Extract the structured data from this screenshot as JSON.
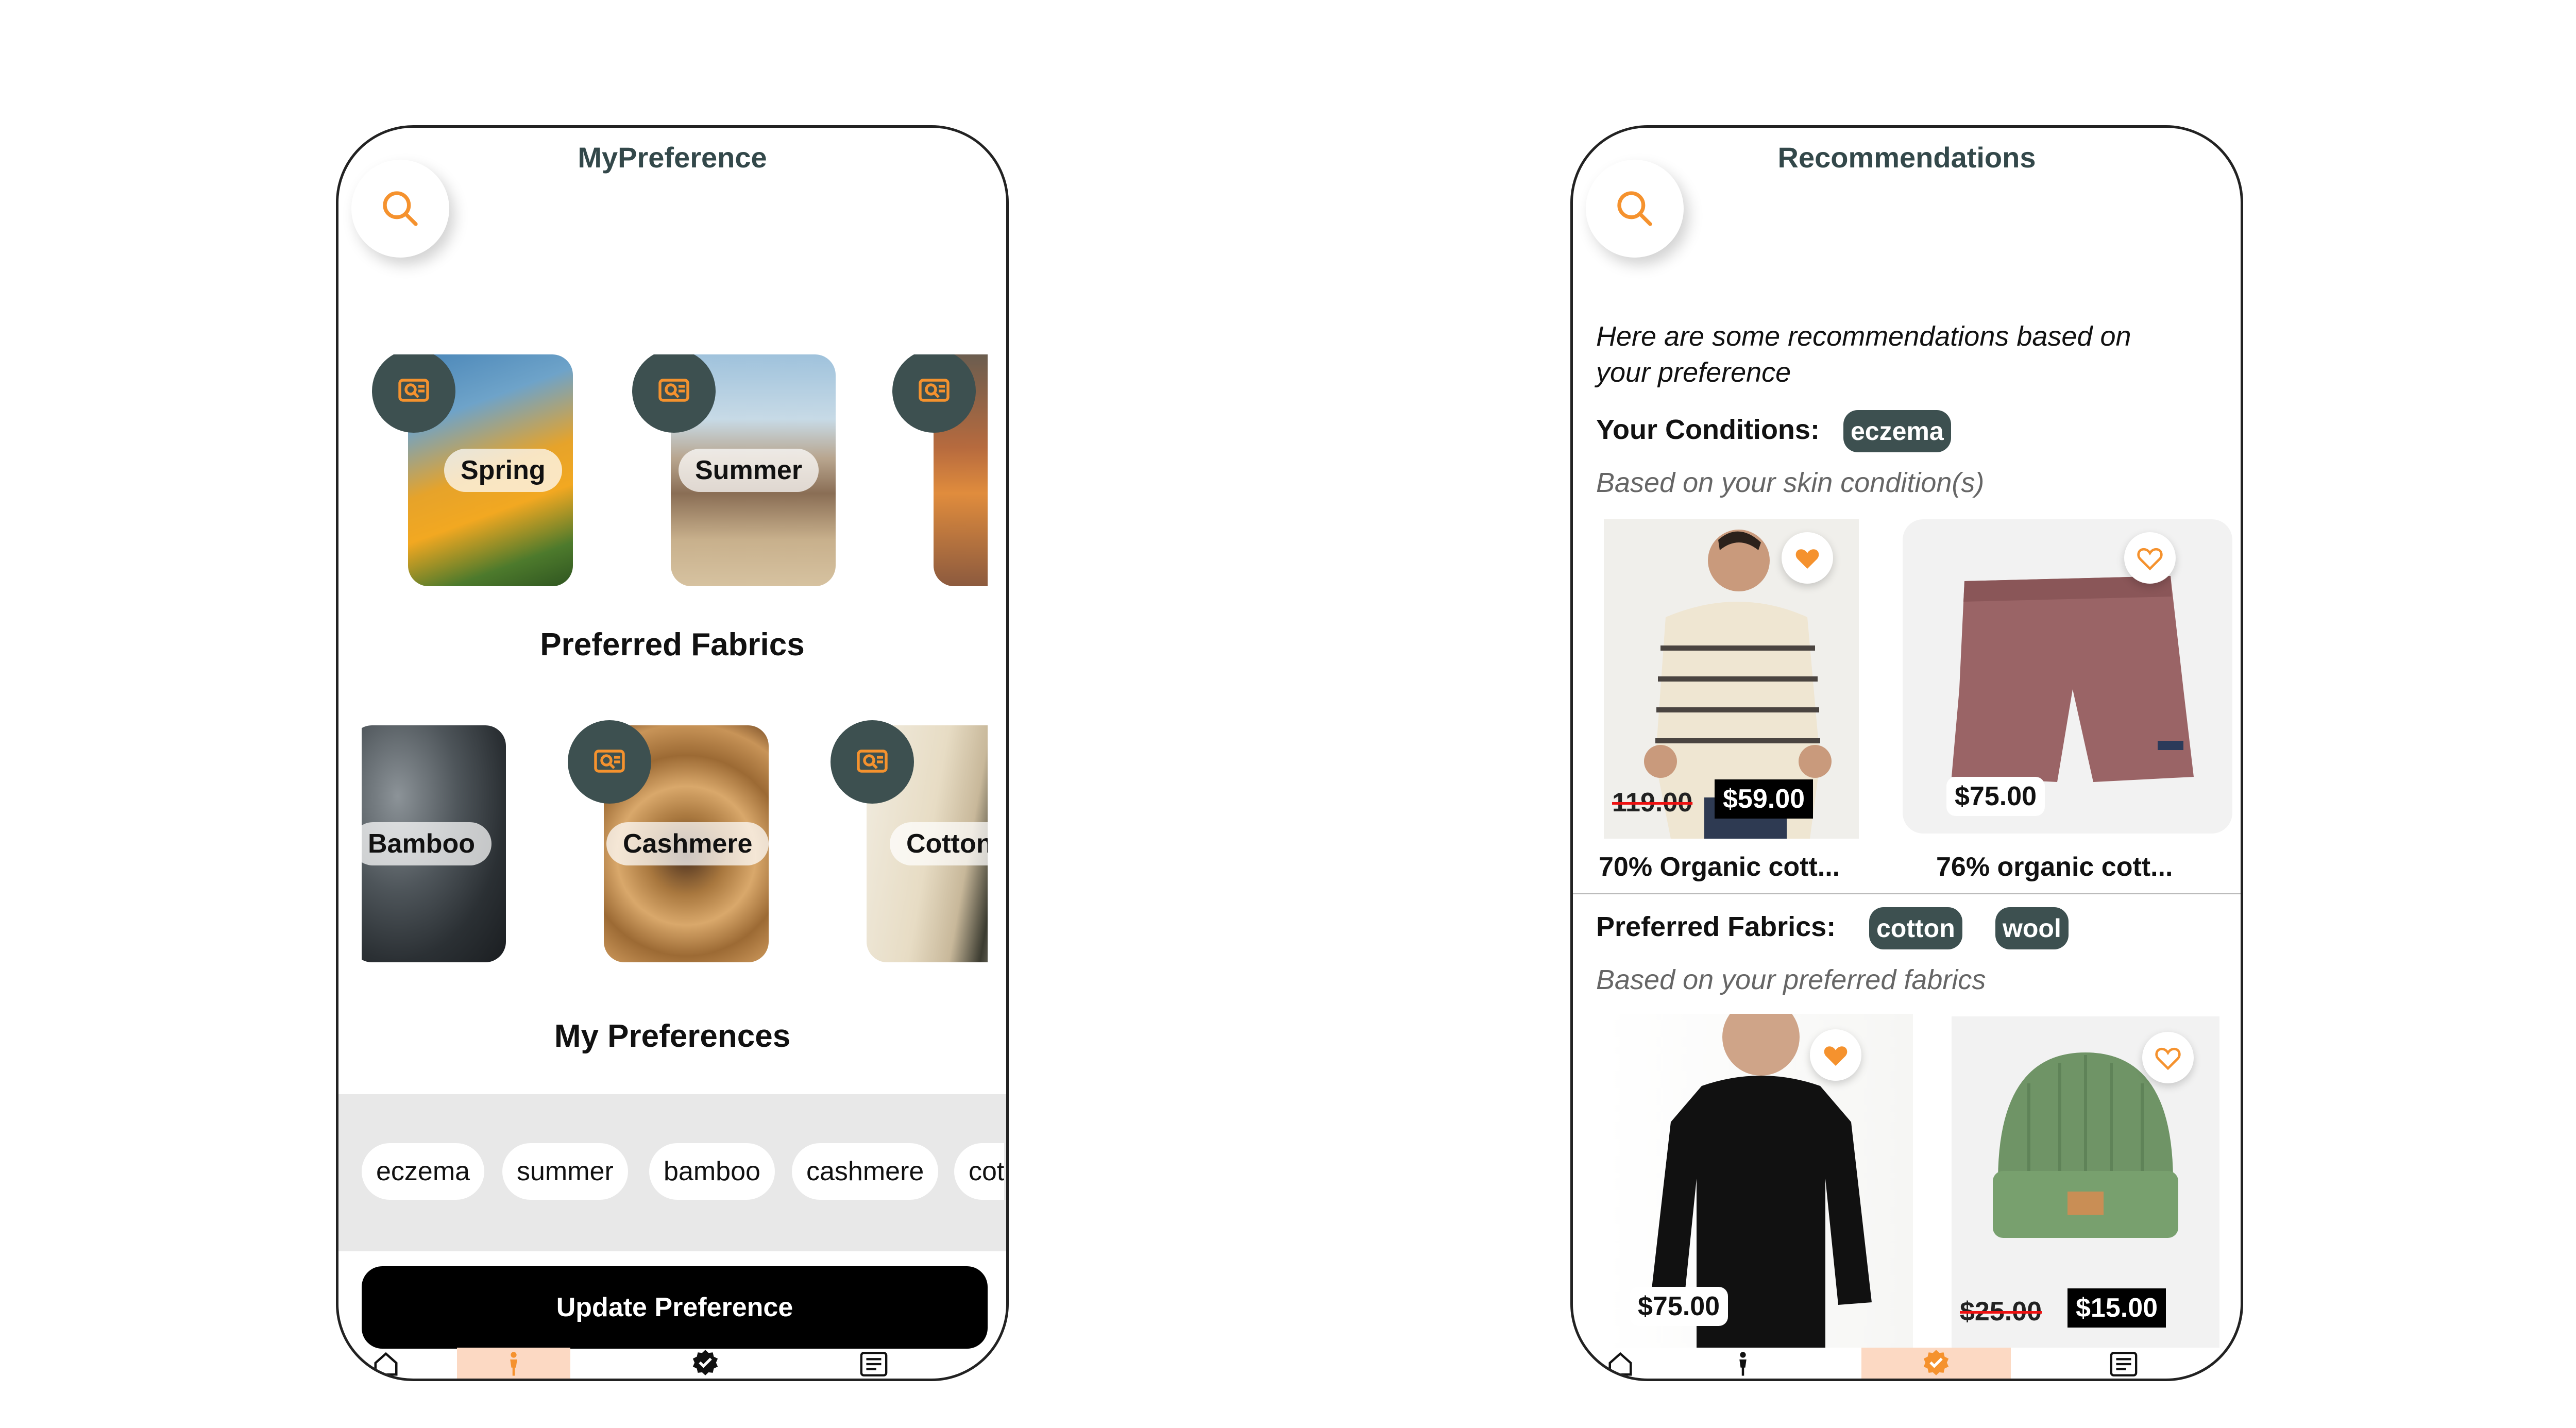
{
  "left_screen": {
    "title": "MyPreference",
    "seasons": [
      {
        "label": "Spring"
      },
      {
        "label": "Summer"
      },
      {
        "label": ""
      }
    ],
    "fabrics_heading": "Preferred Fabrics",
    "fabrics": [
      {
        "label": "Bamboo"
      },
      {
        "label": "Cashmere"
      },
      {
        "label": "Cotton"
      }
    ],
    "prefs_heading": "My Preferences",
    "chips": [
      "eczema",
      "summer",
      "bamboo",
      "cashmere",
      "cot"
    ],
    "button": "Update Preference",
    "tabs": [
      "home-icon",
      "person-icon",
      "verified-icon",
      "news-icon",
      "more-icon"
    ],
    "active_tab": 1
  },
  "right_screen": {
    "title": "Recommendations",
    "intro": "Here are some recommendations based on your preference",
    "conditions_label": "Your Conditions:",
    "conditions": [
      "eczema"
    ],
    "conditions_note": "Based on your skin condition(s)",
    "products_top": [
      {
        "old_price": "119.00",
        "price": "$59.00",
        "name": "70% Organic cott...",
        "favorite": true
      },
      {
        "old_price": "",
        "price": "$75.00",
        "name": "76% organic cott...",
        "favorite": false
      }
    ],
    "fabrics_label": "Preferred Fabrics:",
    "fabrics": [
      "cotton",
      "wool"
    ],
    "fabrics_note": "Based on your preferred fabrics",
    "products_bottom": [
      {
        "old_price": "",
        "price": "$75.00",
        "favorite": true
      },
      {
        "old_price": "$25.00",
        "price": "$15.00",
        "favorite": false
      }
    ],
    "tabs": [
      "home-icon",
      "person-icon",
      "verified-icon",
      "news-icon",
      "more-icon"
    ],
    "active_tab": 2
  },
  "colors": {
    "accent": "#f5922e",
    "dark_teal": "#3d5050",
    "tab_highlight": "#fcd9c3"
  }
}
